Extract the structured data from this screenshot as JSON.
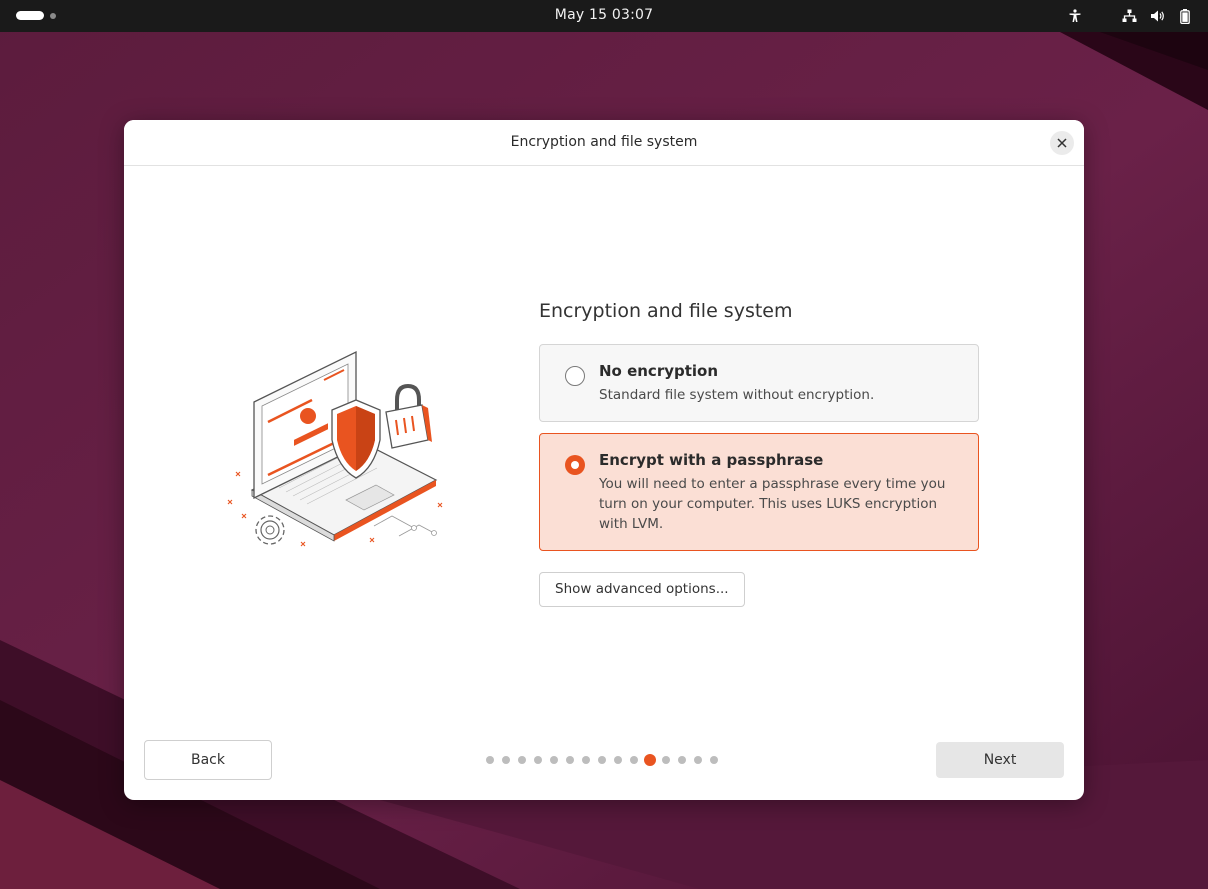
{
  "topbar": {
    "clock": "May 15  03:07",
    "icons": [
      "accessibility-icon",
      "network-icon",
      "volume-icon",
      "battery-icon"
    ]
  },
  "dialog": {
    "title": "Encryption and file system",
    "close_icon": "close-icon",
    "heading": "Encryption and file system",
    "options": [
      {
        "title": "No encryption",
        "description": "Standard file system without encryption.",
        "selected": false
      },
      {
        "title": "Encrypt with a passphrase",
        "description": "You will need to enter a passphrase every time you turn on your computer. This uses LUKS encryption with LVM.",
        "selected": true
      }
    ],
    "advanced_button": "Show advanced options...",
    "back_button": "Back",
    "next_button": "Next",
    "pager": {
      "total": 15,
      "current": 11
    }
  },
  "colors": {
    "accent": "#e95420",
    "selected_bg": "#fbdfd5",
    "topbar": "#1a1a1a"
  }
}
